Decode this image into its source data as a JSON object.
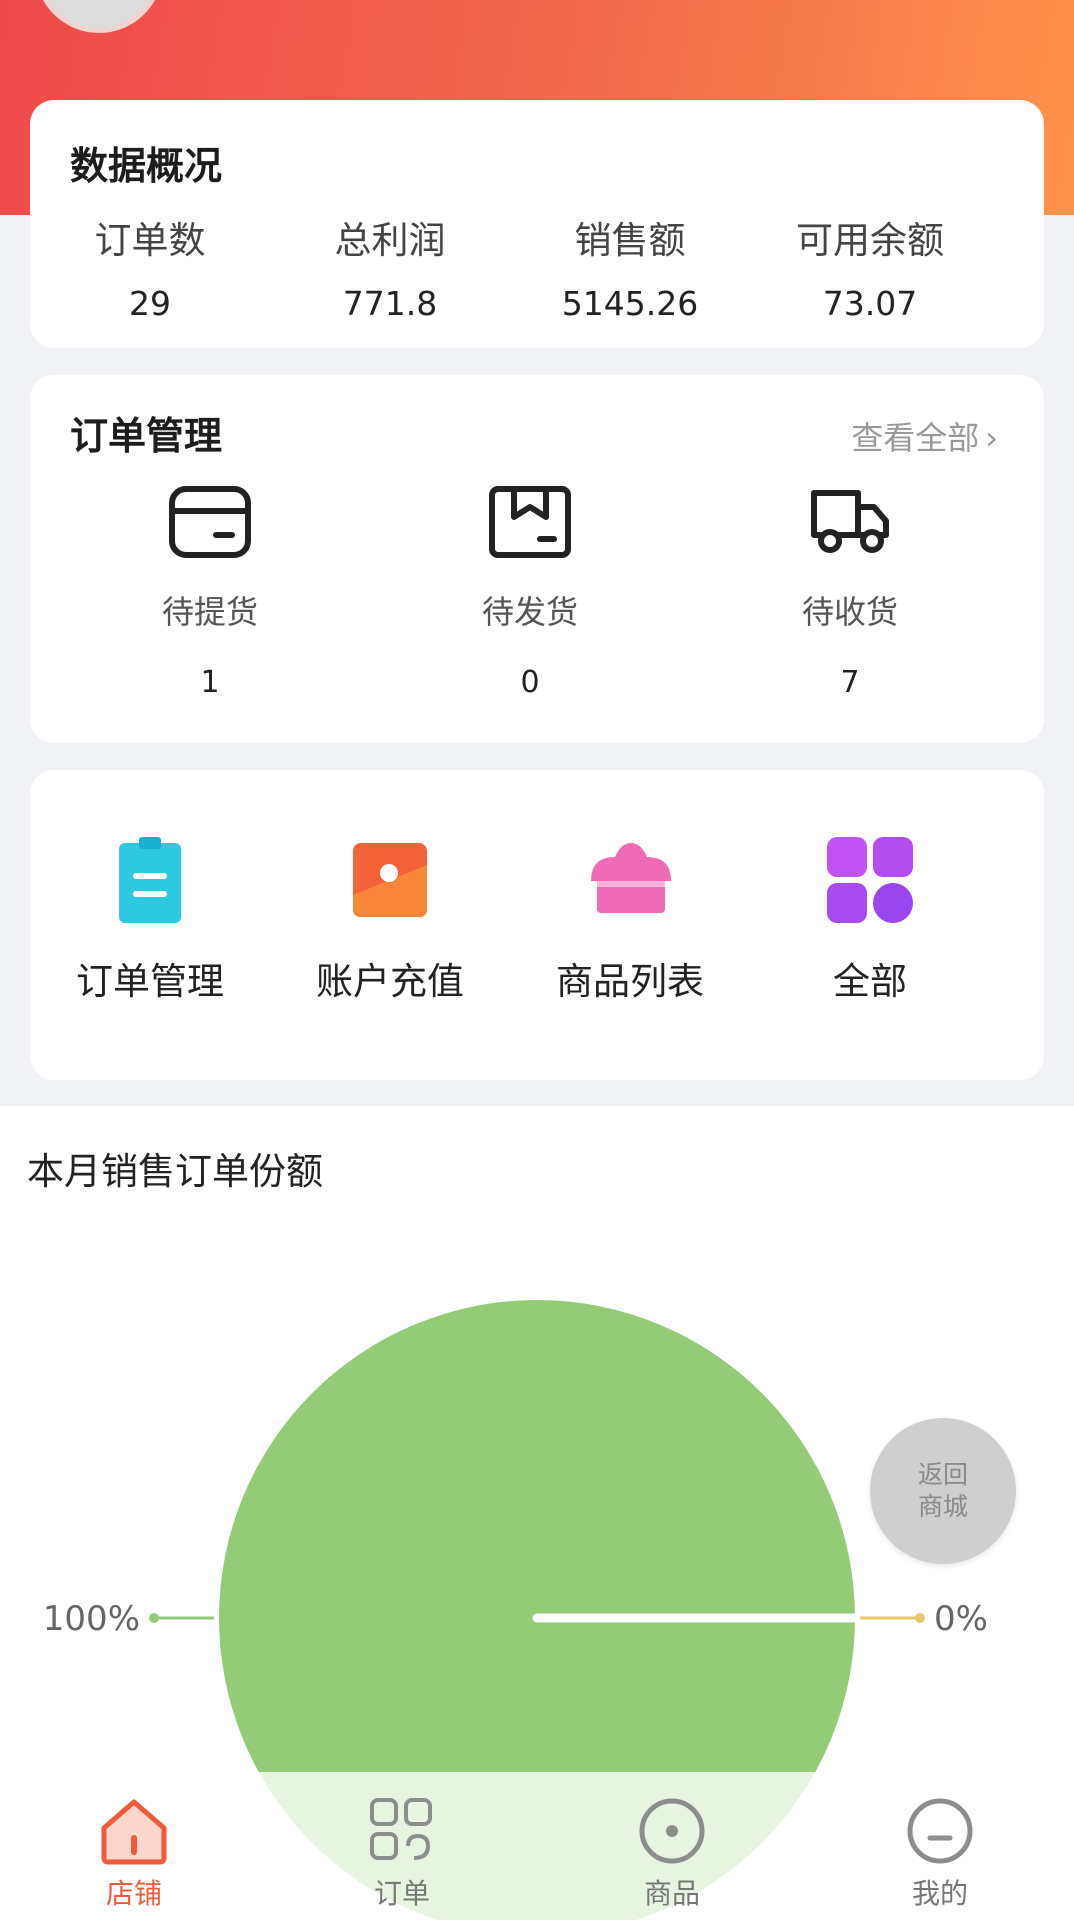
{
  "stats": {
    "title": "数据概况",
    "items": [
      {
        "label": "订单数",
        "value": "29"
      },
      {
        "label": "总利润",
        "value": "771.8"
      },
      {
        "label": "销售额",
        "value": "5145.26"
      },
      {
        "label": "可用余额",
        "value": "73.07"
      }
    ]
  },
  "orders": {
    "title": "订单管理",
    "view_all": "查看全部",
    "items": [
      {
        "label": "待提货",
        "value": "1",
        "icon": "wallet-icon"
      },
      {
        "label": "待发货",
        "value": "0",
        "icon": "box-icon"
      },
      {
        "label": "待收货",
        "value": "7",
        "icon": "truck-icon"
      }
    ]
  },
  "menu": {
    "items": [
      {
        "label": "订单管理",
        "icon": "clipboard-icon",
        "color": "#2ec9e0"
      },
      {
        "label": "账户充值",
        "icon": "recharge-icon",
        "color": "#f4623a"
      },
      {
        "label": "商品列表",
        "icon": "cupcake-icon",
        "color": "#f06bb5"
      },
      {
        "label": "全部",
        "icon": "grid-icon",
        "color": "#a74ef0"
      }
    ]
  },
  "chart_title": "本月销售订单份额",
  "chart_data": {
    "type": "pie",
    "title": "本月销售订单份额",
    "slices": [
      {
        "value": 100,
        "label": "100%",
        "color": "#93cb76"
      },
      {
        "value": 0,
        "label": "0%",
        "color": "#e8c76a"
      }
    ]
  },
  "float_button": {
    "line1": "返回",
    "line2": "商城"
  },
  "tabbar": {
    "items": [
      {
        "label": "店铺",
        "icon": "store-icon",
        "active": true
      },
      {
        "label": "订单",
        "icon": "orders-grid-icon",
        "active": false
      },
      {
        "label": "商品",
        "icon": "goods-icon",
        "active": false
      },
      {
        "label": "我的",
        "icon": "profile-icon",
        "active": false
      }
    ]
  },
  "colors": {
    "accent": "#ef5a3a",
    "hero_start": "#ee4a4a",
    "hero_end": "#ff944a"
  }
}
